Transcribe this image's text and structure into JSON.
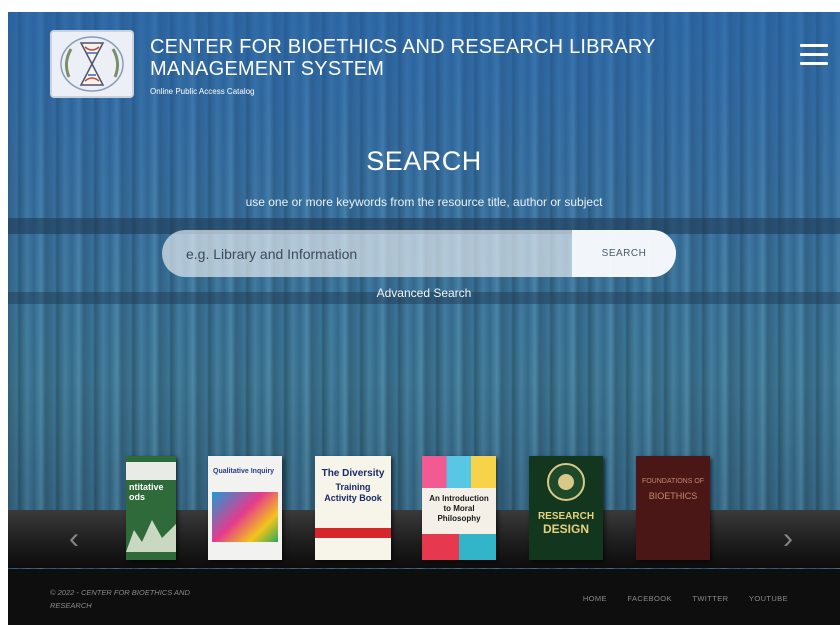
{
  "header": {
    "title": "CENTER FOR BIOETHICS AND RESEARCH LIBRARY MANAGEMENT SYSTEM",
    "subtitle": "Online Public Access Catalog"
  },
  "search": {
    "heading": "SEARCH",
    "hint": "use one or more keywords from the resource title, author or subject",
    "placeholder": "e.g. Library and Information",
    "button_label": "SEARCH",
    "advanced_link": "Advanced Search"
  },
  "carousel": {
    "books": [
      {
        "title_top": "ntitative",
        "title_bottom": "ods",
        "color": "#2f6a3a"
      },
      {
        "title_top": "Qualitative Inquiry",
        "title_bottom": "",
        "color": "#f2f2f0"
      },
      {
        "title_top": "The Diversity",
        "title_bottom": "Training Activity Book",
        "color": "#f7f4ea"
      },
      {
        "title_top": "An Introduction to Moral Philosophy",
        "title_bottom": "",
        "color": "#f4f0e8"
      },
      {
        "title_top": "RESEARCH",
        "title_bottom": "DESIGN",
        "color": "#12361e"
      },
      {
        "title_top": "FOUNDATIONS OF",
        "title_bottom": "BIOETHICS",
        "color": "#4a1616"
      }
    ],
    "prev_icon": "‹",
    "next_icon": "›"
  },
  "footer": {
    "copyright": "© 2022 - CENTER FOR BIOETHICS AND RESEARCH",
    "links": [
      "HOME",
      "FACEBOOK",
      "TWITTER",
      "YOUTUBE"
    ]
  },
  "colors": {
    "overlay": "#2a6cb2",
    "footer": "#0e0e0e",
    "text": "#ffffff"
  }
}
